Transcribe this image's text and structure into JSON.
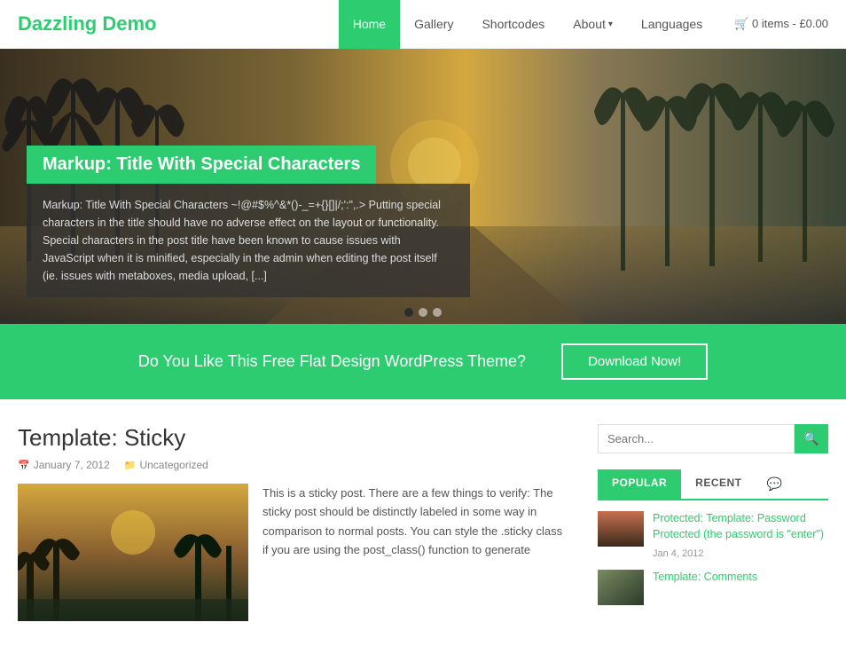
{
  "header": {
    "site_title": "Dazzling Demo",
    "nav": [
      {
        "label": "Home",
        "active": true,
        "id": "home"
      },
      {
        "label": "Gallery",
        "active": false,
        "id": "gallery"
      },
      {
        "label": "Shortcodes",
        "active": false,
        "id": "shortcodes"
      },
      {
        "label": "About",
        "active": false,
        "id": "about",
        "dropdown": true
      },
      {
        "label": "Languages",
        "active": false,
        "id": "languages"
      }
    ],
    "cart": "🛒 0 items - £0.00"
  },
  "hero": {
    "title": "Markup: Title With Special Characters",
    "excerpt": "Markup: Title With Special Characters ~!@#$%^&*()-_=+{}[]|/;':\",.> Putting special characters in the title should have no adverse effect on the layout or functionality. Special characters in the post title have been known to cause issues with JavaScript when it is minified, especially in the admin when editing the post itself (ie. issues with metaboxes, media upload, [...]",
    "dots": [
      {
        "active": true
      },
      {
        "active": false
      },
      {
        "active": false
      }
    ]
  },
  "cta": {
    "text": "Do You Like This Free Flat Design WordPress Theme?",
    "button": "Download Now!"
  },
  "post": {
    "title": "Template: Sticky",
    "date": "January 7, 2012",
    "category": "Uncategorized",
    "excerpt": "This is a sticky post. There are a few things to verify: The sticky post should be distinctly labeled in some way in comparison to normal posts. You can style the .sticky class if you are using the post_class() function to generate"
  },
  "sidebar": {
    "search_placeholder": "Search...",
    "search_button_icon": "🔍",
    "tabs": [
      {
        "label": "POPULAR",
        "active": true
      },
      {
        "label": "RECENT",
        "active": false
      }
    ],
    "tab_icon": "💬",
    "items": [
      {
        "title": "Protected: Template: Password Protected (the password is \"enter\")",
        "date": "Jan 4, 2012"
      },
      {
        "title": "Template: Comments",
        "date": ""
      }
    ]
  },
  "colors": {
    "accent": "#2ecc71",
    "dark": "#333",
    "meta": "#888"
  }
}
